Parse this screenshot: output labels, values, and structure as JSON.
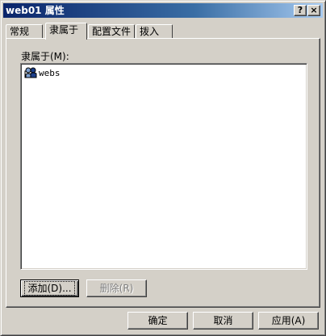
{
  "window": {
    "title": "web01 属性",
    "help_glyph": "?",
    "close_glyph": "×"
  },
  "tabs": [
    {
      "label": "常规",
      "active": false
    },
    {
      "label": "隶属于",
      "active": true
    },
    {
      "label": "配置文件",
      "active": false
    },
    {
      "label": "拨入",
      "active": false
    }
  ],
  "member_of": {
    "label": "隶属于(M):",
    "items": [
      {
        "name": "webs",
        "icon": "group-icon"
      }
    ]
  },
  "panel_buttons": {
    "add_label": "添加(D)...",
    "remove_label": "删除(R)"
  },
  "dialog_buttons": {
    "ok_label": "确定",
    "cancel_label": "取消",
    "apply_label": "应用(A)"
  }
}
